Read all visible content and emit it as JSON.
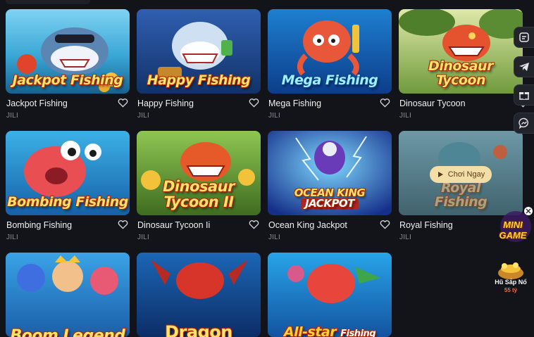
{
  "games": [
    {
      "title": "Jackpot Fishing",
      "provider": "JILI",
      "logo_lines": [
        "Jackpot Fishing"
      ],
      "theme": "shark-ocean"
    },
    {
      "title": "Happy Fishing",
      "provider": "JILI",
      "logo_lines": [
        "Happy Fishing"
      ],
      "theme": "shark-deep"
    },
    {
      "title": "Mega Fishing",
      "provider": "JILI",
      "logo_lines": [
        "Mega Fishing"
      ],
      "theme": "octopus"
    },
    {
      "title": "Dinosaur Tycoon",
      "provider": "JILI",
      "logo_lines": [
        "Dinosaur",
        "Tycoon"
      ],
      "theme": "dino-jungle"
    },
    {
      "title": "Bombing Fishing",
      "provider": "JILI",
      "logo_lines": [
        "Bombing Fishing"
      ],
      "theme": "fish-blue"
    },
    {
      "title": "Dinosaur Tycoon Ii",
      "provider": "JILI",
      "logo_lines": [
        "Dinosaur",
        "Tycoon II"
      ],
      "theme": "dino-gold"
    },
    {
      "title": "Ocean King Jackpot",
      "provider": "JILI",
      "logo_lines": [
        "OCEAN KING",
        "JACKPOT"
      ],
      "theme": "ocean-king"
    },
    {
      "title": "Royal Fishing",
      "provider": "JILI",
      "logo_lines": [
        "Royal",
        "Fishing"
      ],
      "theme": "royal"
    },
    {
      "title": "",
      "provider": "",
      "logo_lines": [
        "Boom Legend"
      ],
      "theme": "boom"
    },
    {
      "title": "",
      "provider": "",
      "logo_lines": [
        "Dragon"
      ],
      "theme": "dragon"
    },
    {
      "title": "",
      "provider": "",
      "logo_lines": [
        "All-star",
        "Fishing"
      ],
      "theme": "allstar"
    }
  ],
  "hover_card": {
    "play_label": "Chơi Ngay"
  },
  "sidebar": {
    "icons": [
      "support-icon",
      "telegram-icon",
      "gift-icon",
      "messenger-icon"
    ]
  },
  "promo": {
    "minigame_label": "MINI GAME",
    "jackpot_label": "Hũ Sắp Nổ",
    "jackpot_amount": "55 tỷ"
  },
  "colors": {
    "background": "#131419",
    "card_text": "#f1f1f3",
    "provider_text": "#8b8d96",
    "accent_gold": "#ffe36b"
  }
}
